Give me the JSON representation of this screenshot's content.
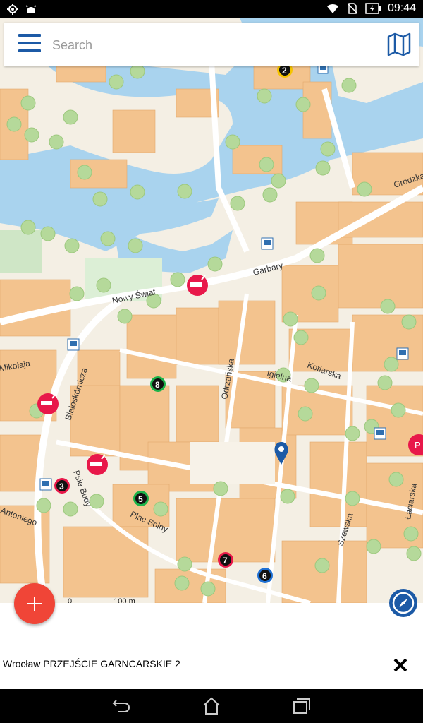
{
  "status": {
    "time": "09:44",
    "icons": [
      "gps-icon",
      "android-debug-icon",
      "wifi-icon",
      "no-sim-icon",
      "battery-charging-icon"
    ]
  },
  "search": {
    "placeholder": "Search",
    "value": ""
  },
  "map": {
    "street_labels": [
      "Nowy Świat",
      "Garbary",
      "Białoskórnicza",
      "Odrzańska",
      "Igielna",
      "Kotlarska",
      "Psie Budy",
      "Plac Solny",
      "Szewska",
      "Łaciarska",
      "Grodzka",
      "Mikołaja",
      "Antoniego"
    ],
    "markers": [
      "2",
      "3",
      "5",
      "6",
      "7",
      "8"
    ],
    "scale": {
      "zero": "0",
      "end": "100 m"
    }
  },
  "bottom": {
    "address": "Wrocław PRZEJŚCIE GARNCARSKIE 2"
  },
  "colors": {
    "accent": "#1c5aa6",
    "fab": "#f04537",
    "parking": "#e8184a",
    "water": "#a9d3ee",
    "building": "#f3c38e",
    "tree": "#b5d99a"
  }
}
